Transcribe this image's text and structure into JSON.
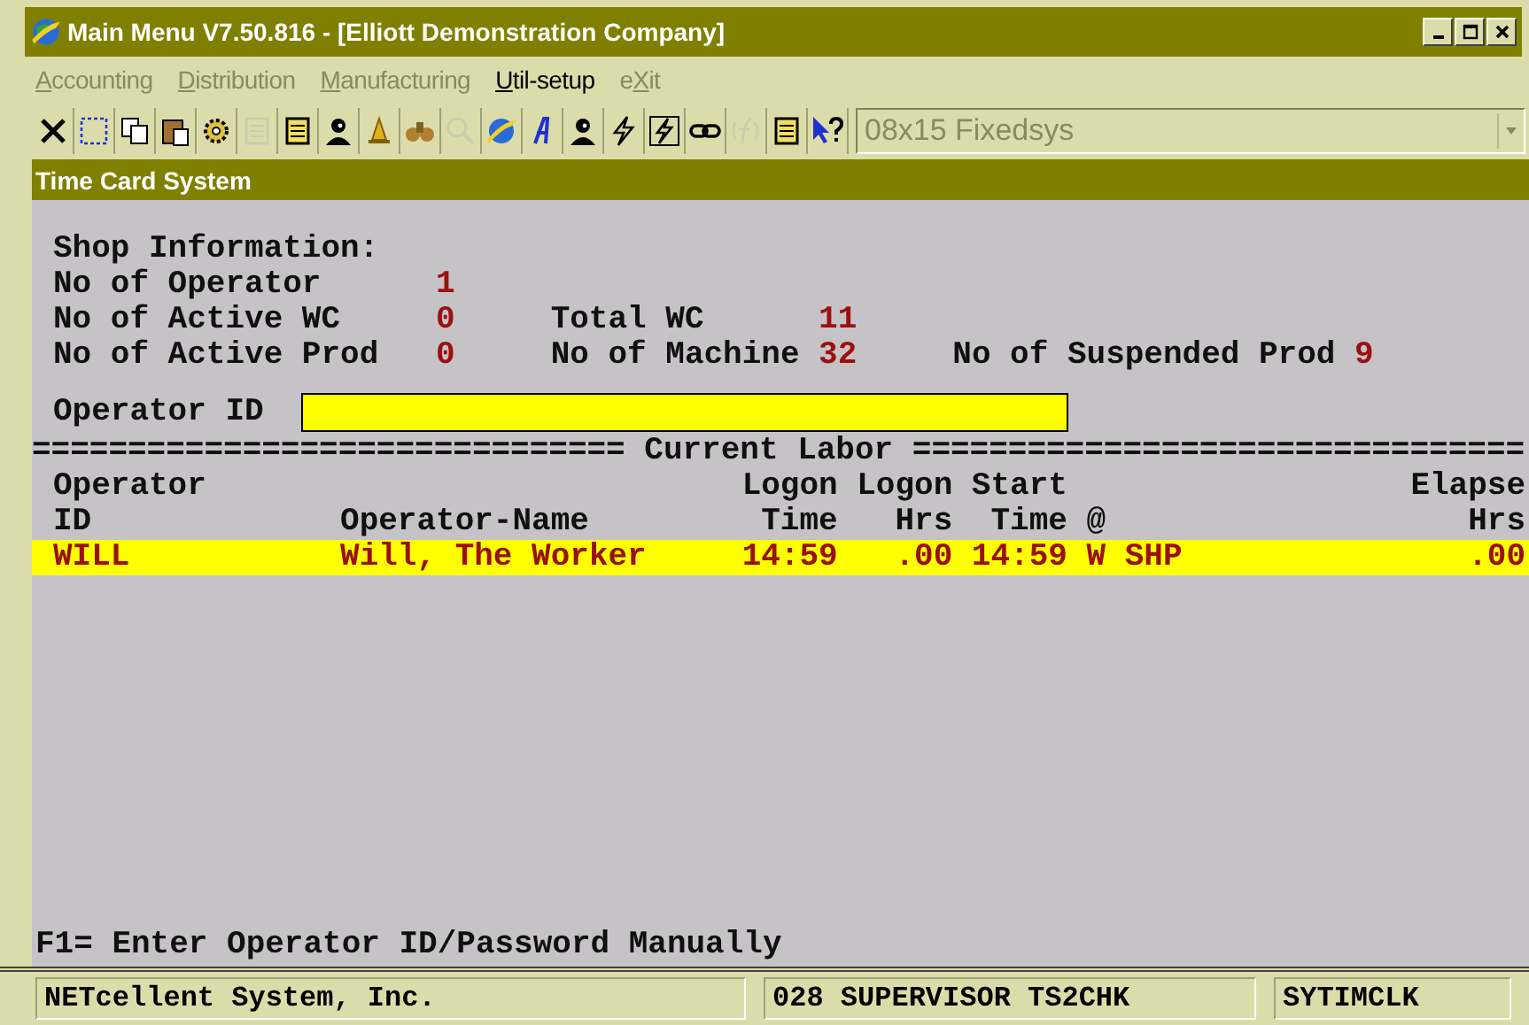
{
  "window": {
    "title": "Main Menu V7.50.816 - [Elliott Demonstration Company]"
  },
  "menu": [
    {
      "accel": "A",
      "after": "ccounting",
      "disabled": true
    },
    {
      "accel": "D",
      "after": "istribution",
      "disabled": true
    },
    {
      "accel": "M",
      "after": "anufacturing",
      "disabled": true
    },
    {
      "accel": "U",
      "after": "til-setup",
      "disabled": false
    },
    {
      "before": "e",
      "accel": "X",
      "after": "it",
      "disabled": true
    }
  ],
  "toolbar": [
    {
      "kind": "close",
      "disabled": false
    },
    {
      "kind": "select",
      "disabled": false
    },
    {
      "kind": "copy",
      "disabled": false
    },
    {
      "kind": "paste",
      "disabled": false
    },
    {
      "kind": "gear",
      "disabled": false
    },
    {
      "kind": "form",
      "disabled": true
    },
    {
      "kind": "list",
      "disabled": false
    },
    {
      "kind": "person",
      "disabled": false
    },
    {
      "kind": "bell",
      "disabled": false
    },
    {
      "kind": "binoculars",
      "disabled": false
    },
    {
      "kind": "magnifier",
      "disabled": true
    },
    {
      "kind": "globe",
      "disabled": false
    },
    {
      "kind": "letter",
      "disabled": false
    },
    {
      "kind": "head",
      "disabled": false
    },
    {
      "kind": "bolt",
      "disabled": false
    },
    {
      "kind": "bolt-box",
      "disabled": false
    },
    {
      "kind": "link",
      "disabled": false
    },
    {
      "kind": "function",
      "disabled": true
    },
    {
      "kind": "list",
      "disabled": false
    },
    {
      "kind": "help",
      "disabled": false
    }
  ],
  "font_select": {
    "value": "08x15 Fixedsys",
    "disabled": true
  },
  "subtitle": "Time Card System",
  "shop": {
    "heading": "Shop Information:",
    "rows": [
      [
        {
          "label": "No of Operator",
          "value": "1"
        }
      ],
      [
        {
          "label": "No of Active WC",
          "value": "0"
        },
        {
          "label": "Total WC",
          "value": "11"
        }
      ],
      [
        {
          "label": "No of Active Prod",
          "value": "0"
        },
        {
          "label": "No of Machine",
          "value": "32"
        },
        {
          "label": "No of Suspended Prod",
          "value": "9"
        }
      ]
    ]
  },
  "operator_field": {
    "label": "Operator ID"
  },
  "separator": {
    "left": "===============================",
    "title": "Current Labor",
    "right": "================================"
  },
  "table": {
    "columns": [
      {
        "top": "Operator",
        "bottom": "ID"
      },
      {
        "bottom": "Operator-Name"
      },
      {
        "top": "Logon",
        "bottom": "Time"
      },
      {
        "top": "Logon",
        "bottom": "Hrs"
      },
      {
        "top": "Start",
        "bottom": "Time"
      },
      {
        "bottom": "@"
      },
      {
        "top": "Elapse",
        "bottom": "Hrs"
      }
    ],
    "rows": [
      {
        "selected": true,
        "cells": [
          "WILL",
          "Will, The Worker",
          "14:59",
          ".00",
          "14:59",
          "W SHP",
          ".00"
        ]
      }
    ]
  },
  "hint": "F1= Enter Operator ID/Password Manually",
  "status_bar": [
    "NETcellent System, Inc.",
    "028 SUPERVISOR TS2CHK",
    "SYTIMCLK"
  ]
}
